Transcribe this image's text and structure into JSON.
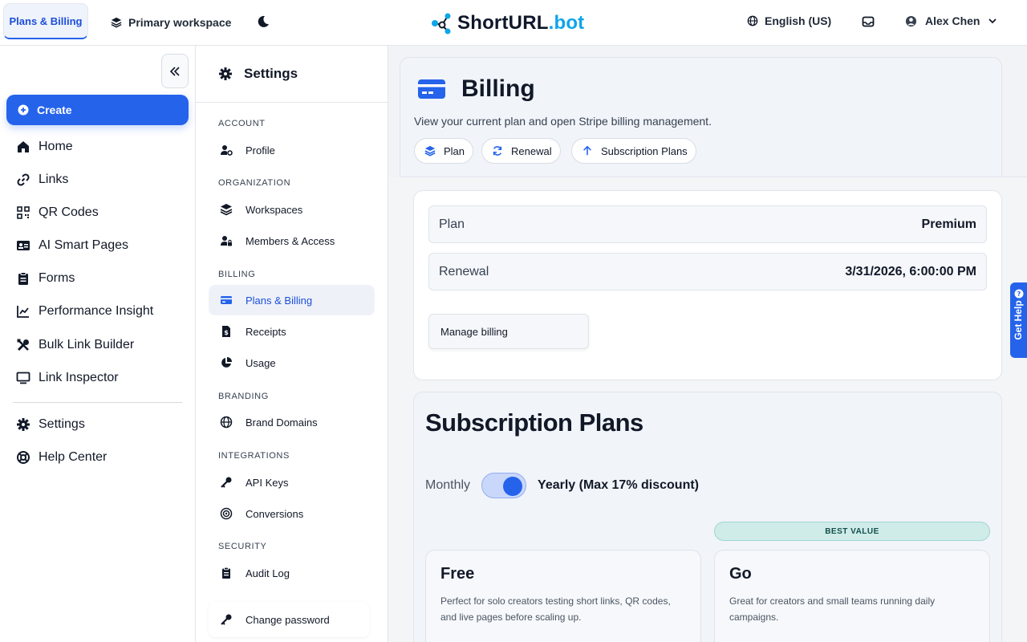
{
  "topbar": {
    "active_tab": "Plans & Billing",
    "workspace": "Primary workspace",
    "logo_main": "ShortURL",
    "logo_suffix": ".bot",
    "language": "English (US)",
    "user_name": "Alex Chen"
  },
  "sidebar": {
    "create_label": "Create",
    "items": [
      {
        "label": "Home",
        "icon": "home-icon"
      },
      {
        "label": "Links",
        "icon": "link-icon"
      },
      {
        "label": "QR Codes",
        "icon": "qr-icon"
      },
      {
        "label": "AI Smart Pages",
        "icon": "id-card-icon"
      },
      {
        "label": "Forms",
        "icon": "clipboard-icon"
      },
      {
        "label": "Performance Insight",
        "icon": "chart-icon"
      },
      {
        "label": "Bulk Link Builder",
        "icon": "tools-icon"
      },
      {
        "label": "Link Inspector",
        "icon": "monitor-icon"
      }
    ],
    "bottom_items": [
      {
        "label": "Settings",
        "icon": "gear-icon"
      },
      {
        "label": "Help Center",
        "icon": "lifebuoy-icon"
      }
    ]
  },
  "settings": {
    "title": "Settings",
    "sections": {
      "account": "ACCOUNT",
      "organization": "ORGANIZATION",
      "billing": "BILLING",
      "branding": "BRANDING",
      "integrations": "INTEGRATIONS",
      "security": "SECURITY"
    },
    "items": {
      "profile": "Profile",
      "workspaces": "Workspaces",
      "members": "Members & Access",
      "plans": "Plans & Billing",
      "receipts": "Receipts",
      "usage": "Usage",
      "domains": "Brand Domains",
      "api_keys": "API Keys",
      "conversions": "Conversions",
      "audit_log": "Audit Log",
      "change_password": "Change password"
    }
  },
  "billing": {
    "title": "Billing",
    "subtitle": "View your current plan and open Stripe billing management.",
    "chips": {
      "plan": "Plan",
      "renewal": "Renewal",
      "subscription_plans": "Subscription Plans"
    },
    "plan_key": "Plan",
    "plan_value": "Premium",
    "renewal_key": "Renewal",
    "renewal_value": "3/31/2026, 6:00:00 PM",
    "manage_label": "Manage billing"
  },
  "subscriptions": {
    "title": "Subscription Plans",
    "monthly_label": "Monthly",
    "yearly_label": "Yearly (Max 17% discount)",
    "yearly_selected": true,
    "best_value": "BEST VALUE",
    "tiers": [
      {
        "name": "Free",
        "desc": "Perfect for solo creators testing short links, QR codes, and live pages before scaling up."
      },
      {
        "name": "Go",
        "desc": "Great for creators and small teams running daily campaigns."
      }
    ]
  },
  "help_tab": "Get Help",
  "colors": {
    "accent": "#2563eb",
    "logo_accent": "#0ea5e9",
    "best_value_bg": "#cfece9"
  }
}
